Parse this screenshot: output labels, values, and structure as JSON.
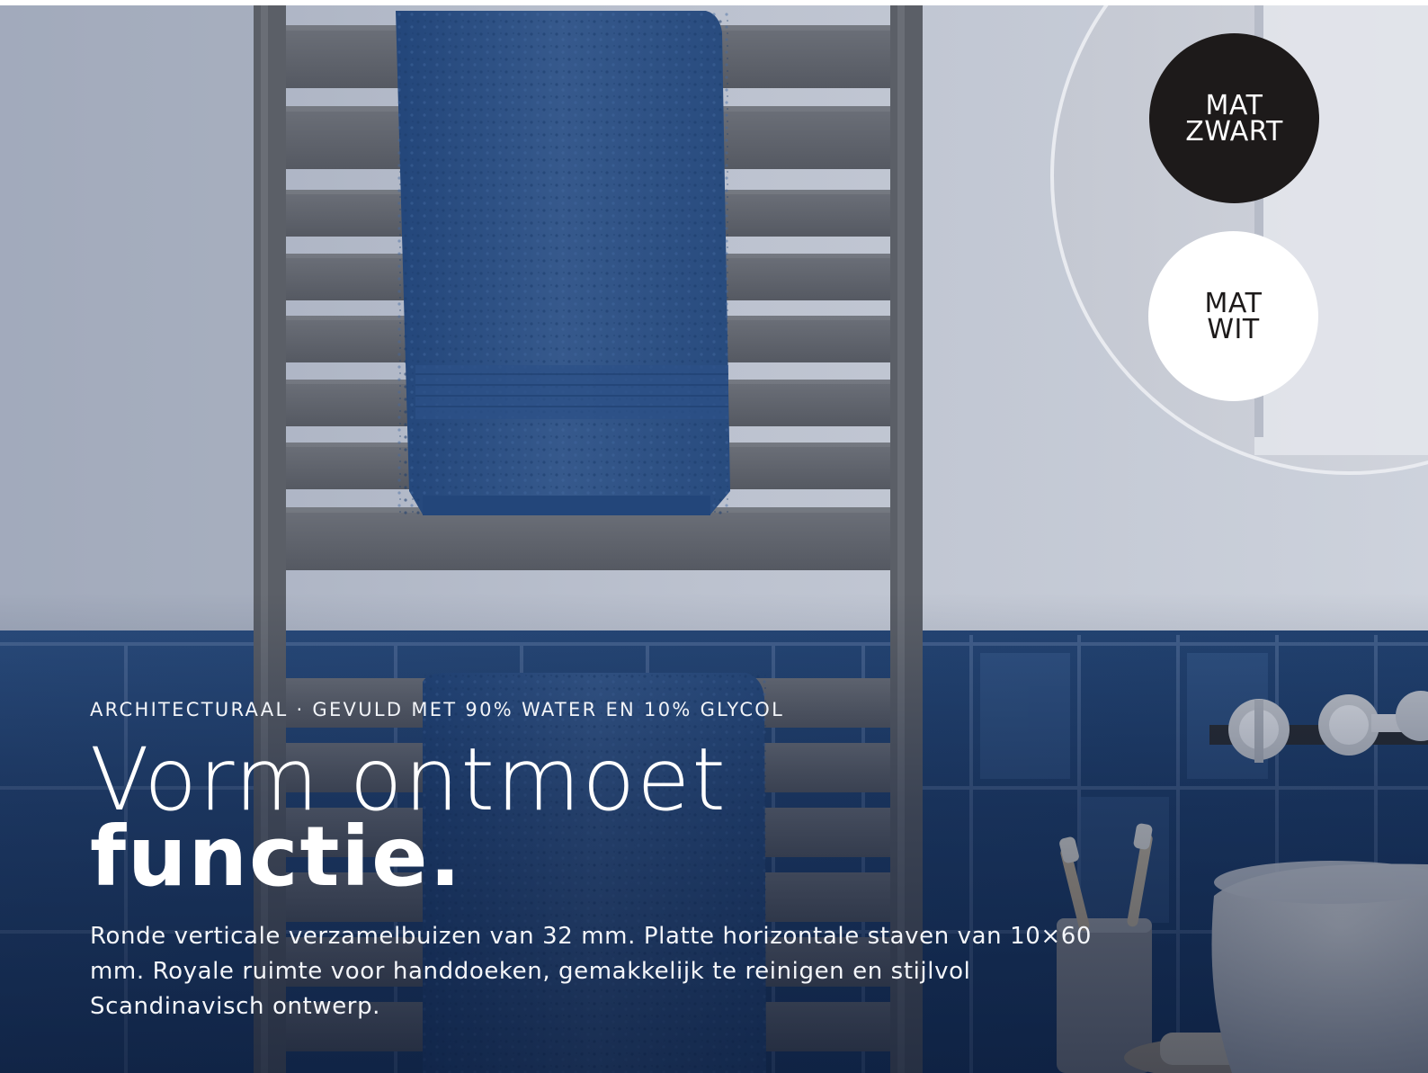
{
  "hero": {
    "eyebrow": "ARCHITECTURAAL · GEVULD MET 90% WATER EN 10% GLYCOL",
    "headline_light": "Vorm ontmoet",
    "headline_bold": "functie.",
    "body": "Ronde verticale verzamelbuizen van 32 mm. Platte horizontale staven van 10×60 mm. Royale ruimte voor handdoeken, gemakkelijk te reinigen en stijlvol Scandinavisch ontwerp."
  },
  "swatches": [
    {
      "line1": "MAT",
      "line2": "ZWART",
      "color": "#1d1a1a"
    },
    {
      "line1": "MAT",
      "line2": "WIT",
      "color": "#ffffff"
    }
  ],
  "colors": {
    "wall": "#b9bfcc",
    "tile": "#1f4272",
    "towel": "#2e5285",
    "radiator": "#5c6068"
  }
}
